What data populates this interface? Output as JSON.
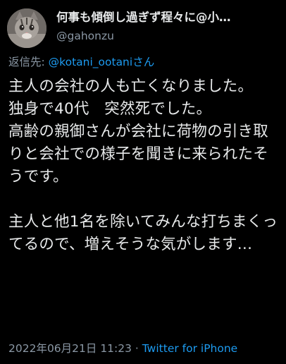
{
  "user": {
    "display_name": "何事も傾倒し過ぎず程々に@小…",
    "handle": "@gahonzu"
  },
  "reply": {
    "prefix": "返信先: ",
    "mention": "@kotani_ootaniさん"
  },
  "tweet": {
    "text": "主人の会社の人も亡くなりました。\n独身で40代　突然死でした。\n高齢の親御さんが会社に荷物の引き取りと会社での様子を聞きに来られたそうです。\n\n主人と他1名を除いてみんな打ちまくってるので、増えそうな気がします…"
  },
  "meta": {
    "timestamp": "2022年06月21日 11:23",
    "separator": " · ",
    "source": "Twitter for iPhone"
  },
  "colors": {
    "background": "#000000",
    "text": "#e7e9ea",
    "secondary": "#8b98a5",
    "link": "#1d9bf0"
  }
}
